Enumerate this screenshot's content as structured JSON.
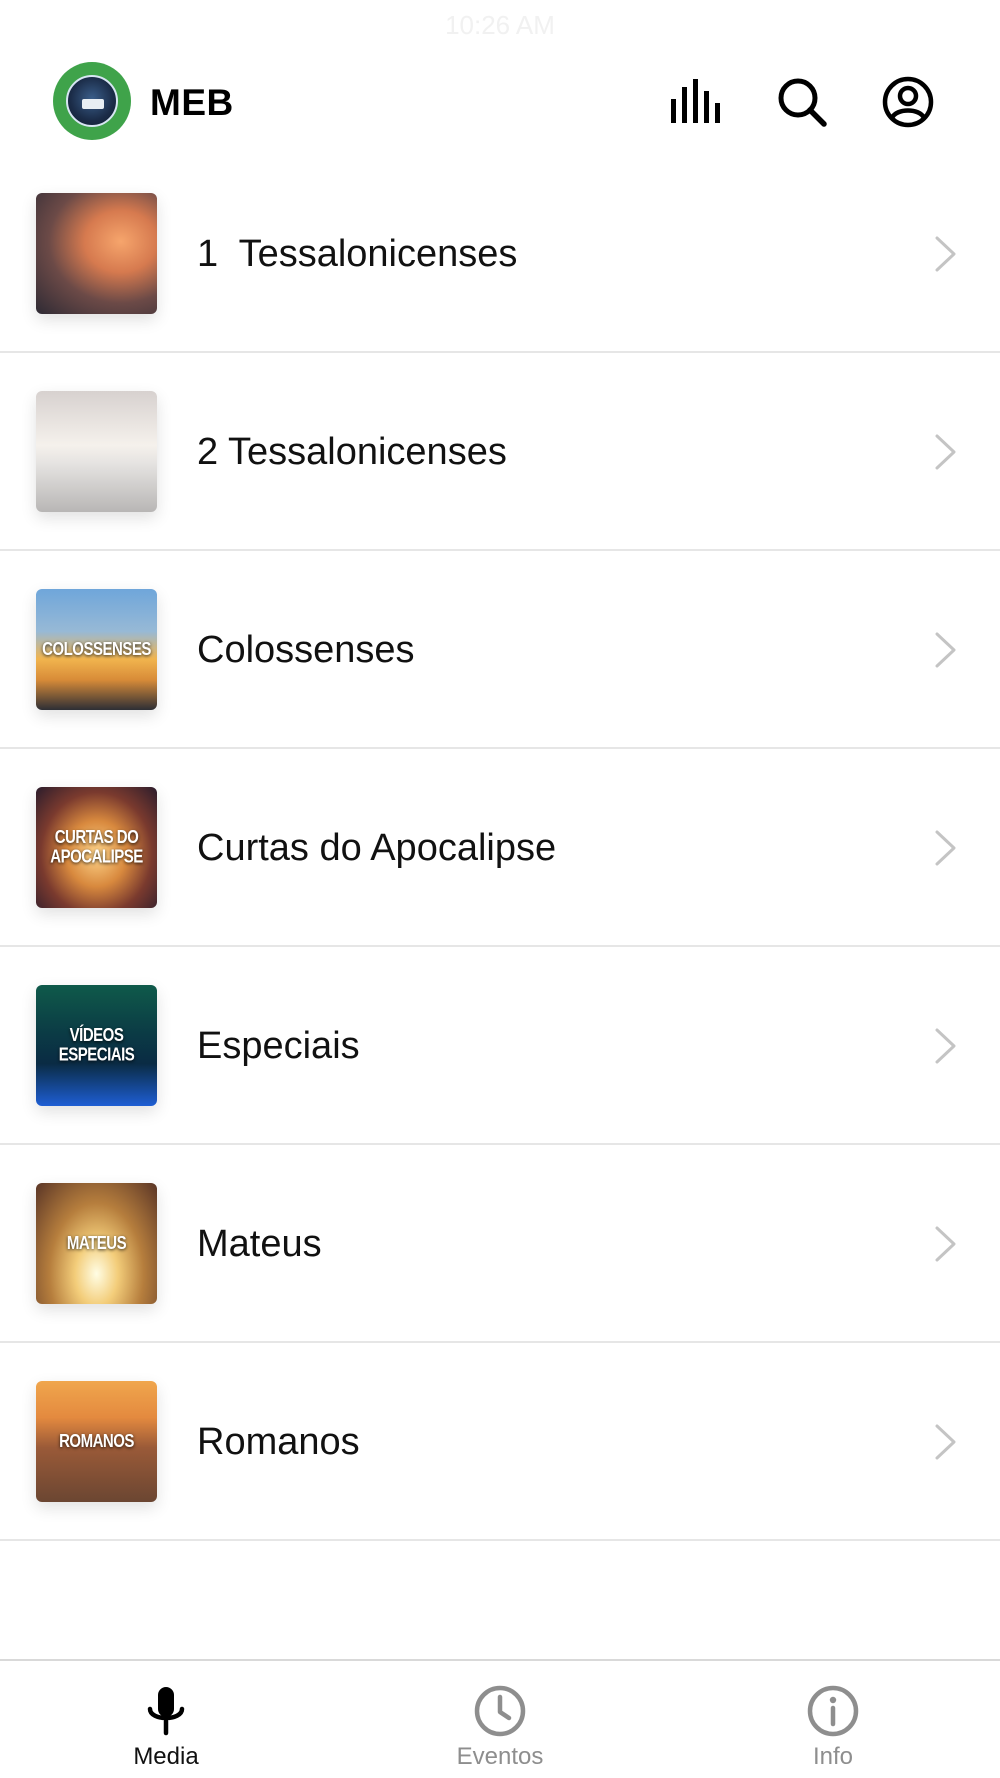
{
  "status_bar": {
    "time": "10:26 AM"
  },
  "header": {
    "logo_icon": "meb-logo",
    "title": "MEB",
    "icons": [
      "equalizer-icon",
      "search-icon",
      "account-icon"
    ]
  },
  "items": [
    {
      "title": "1  Tessalonicenses",
      "thumb_text": ""
    },
    {
      "title": "2 Tessalonicenses",
      "thumb_text": ""
    },
    {
      "title": "Colossenses",
      "thumb_text": "COLOSSENSES"
    },
    {
      "title": "Curtas do Apocalipse",
      "thumb_text": "CURTAS DO\nAPOCALIPSE"
    },
    {
      "title": "Especiais",
      "thumb_text": "VÍDEOS\nESPECIAIS"
    },
    {
      "title": "Mateus",
      "thumb_text": "MATEUS"
    },
    {
      "title": "Romanos",
      "thumb_text": "ROMANOS"
    }
  ],
  "tabs": [
    {
      "label": "Media",
      "icon": "microphone-icon",
      "active": true
    },
    {
      "label": "Eventos",
      "icon": "clock-icon",
      "active": false
    },
    {
      "label": "Info",
      "icon": "info-icon",
      "active": false
    }
  ],
  "colors": {
    "logo_green": "#3fa34a",
    "inactive_tab": "#8e8e8e",
    "separator": "#e6e6e6"
  }
}
